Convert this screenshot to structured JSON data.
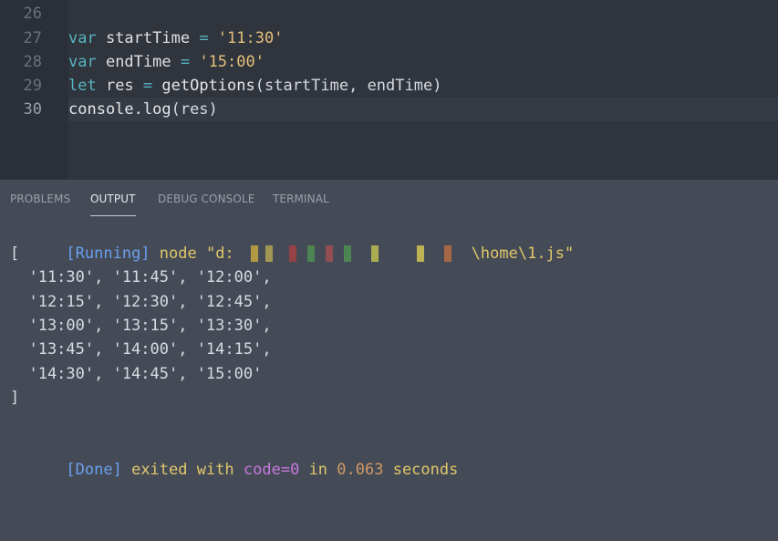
{
  "editor": {
    "lines": [
      {
        "num": "26",
        "tokens": []
      },
      {
        "num": "27",
        "tokens": [
          [
            "kw",
            "var"
          ],
          [
            "id",
            " startTime "
          ],
          [
            "op",
            "="
          ],
          [
            "str",
            " '11:30'"
          ]
        ]
      },
      {
        "num": "28",
        "tokens": [
          [
            "kw",
            "var"
          ],
          [
            "id",
            " endTime "
          ],
          [
            "op",
            "="
          ],
          [
            "str",
            " '15:00'"
          ]
        ]
      },
      {
        "num": "29",
        "tokens": [
          [
            "kw",
            "let"
          ],
          [
            "id",
            " res "
          ],
          [
            "op",
            "="
          ],
          [
            "fn",
            " getOptions"
          ],
          [
            "punc",
            "(startTime, endTime)"
          ]
        ]
      },
      {
        "num": "30",
        "tokens": [
          [
            "fn",
            "console.log"
          ],
          [
            "punc",
            "(res)"
          ]
        ]
      }
    ]
  },
  "panel": {
    "tabs": [
      {
        "label": "PROBLEMS",
        "active": false
      },
      {
        "label": "OUTPUT",
        "active": true
      },
      {
        "label": "DEBUG CONSOLE",
        "active": false
      },
      {
        "label": "TERMINAL",
        "active": false
      }
    ],
    "output": {
      "running_tag": "[Running]",
      "command_prefix": " node \"d:",
      "command_suffix": "\\home\\1.js\"",
      "result_lines": [
        "[",
        "  '11:30', '11:45', '12:00',",
        "  '12:15', '12:30', '12:45',",
        "  '13:00', '13:15', '13:30',",
        "  '13:45', '14:00', '14:15',",
        "  '14:30', '14:45', '15:00'",
        "]"
      ],
      "done_tag": "[Done]",
      "done_text_1": " exited with ",
      "done_code": "code=0",
      "done_text_2": " in ",
      "done_time": "0.063",
      "done_text_3": " seconds"
    }
  }
}
